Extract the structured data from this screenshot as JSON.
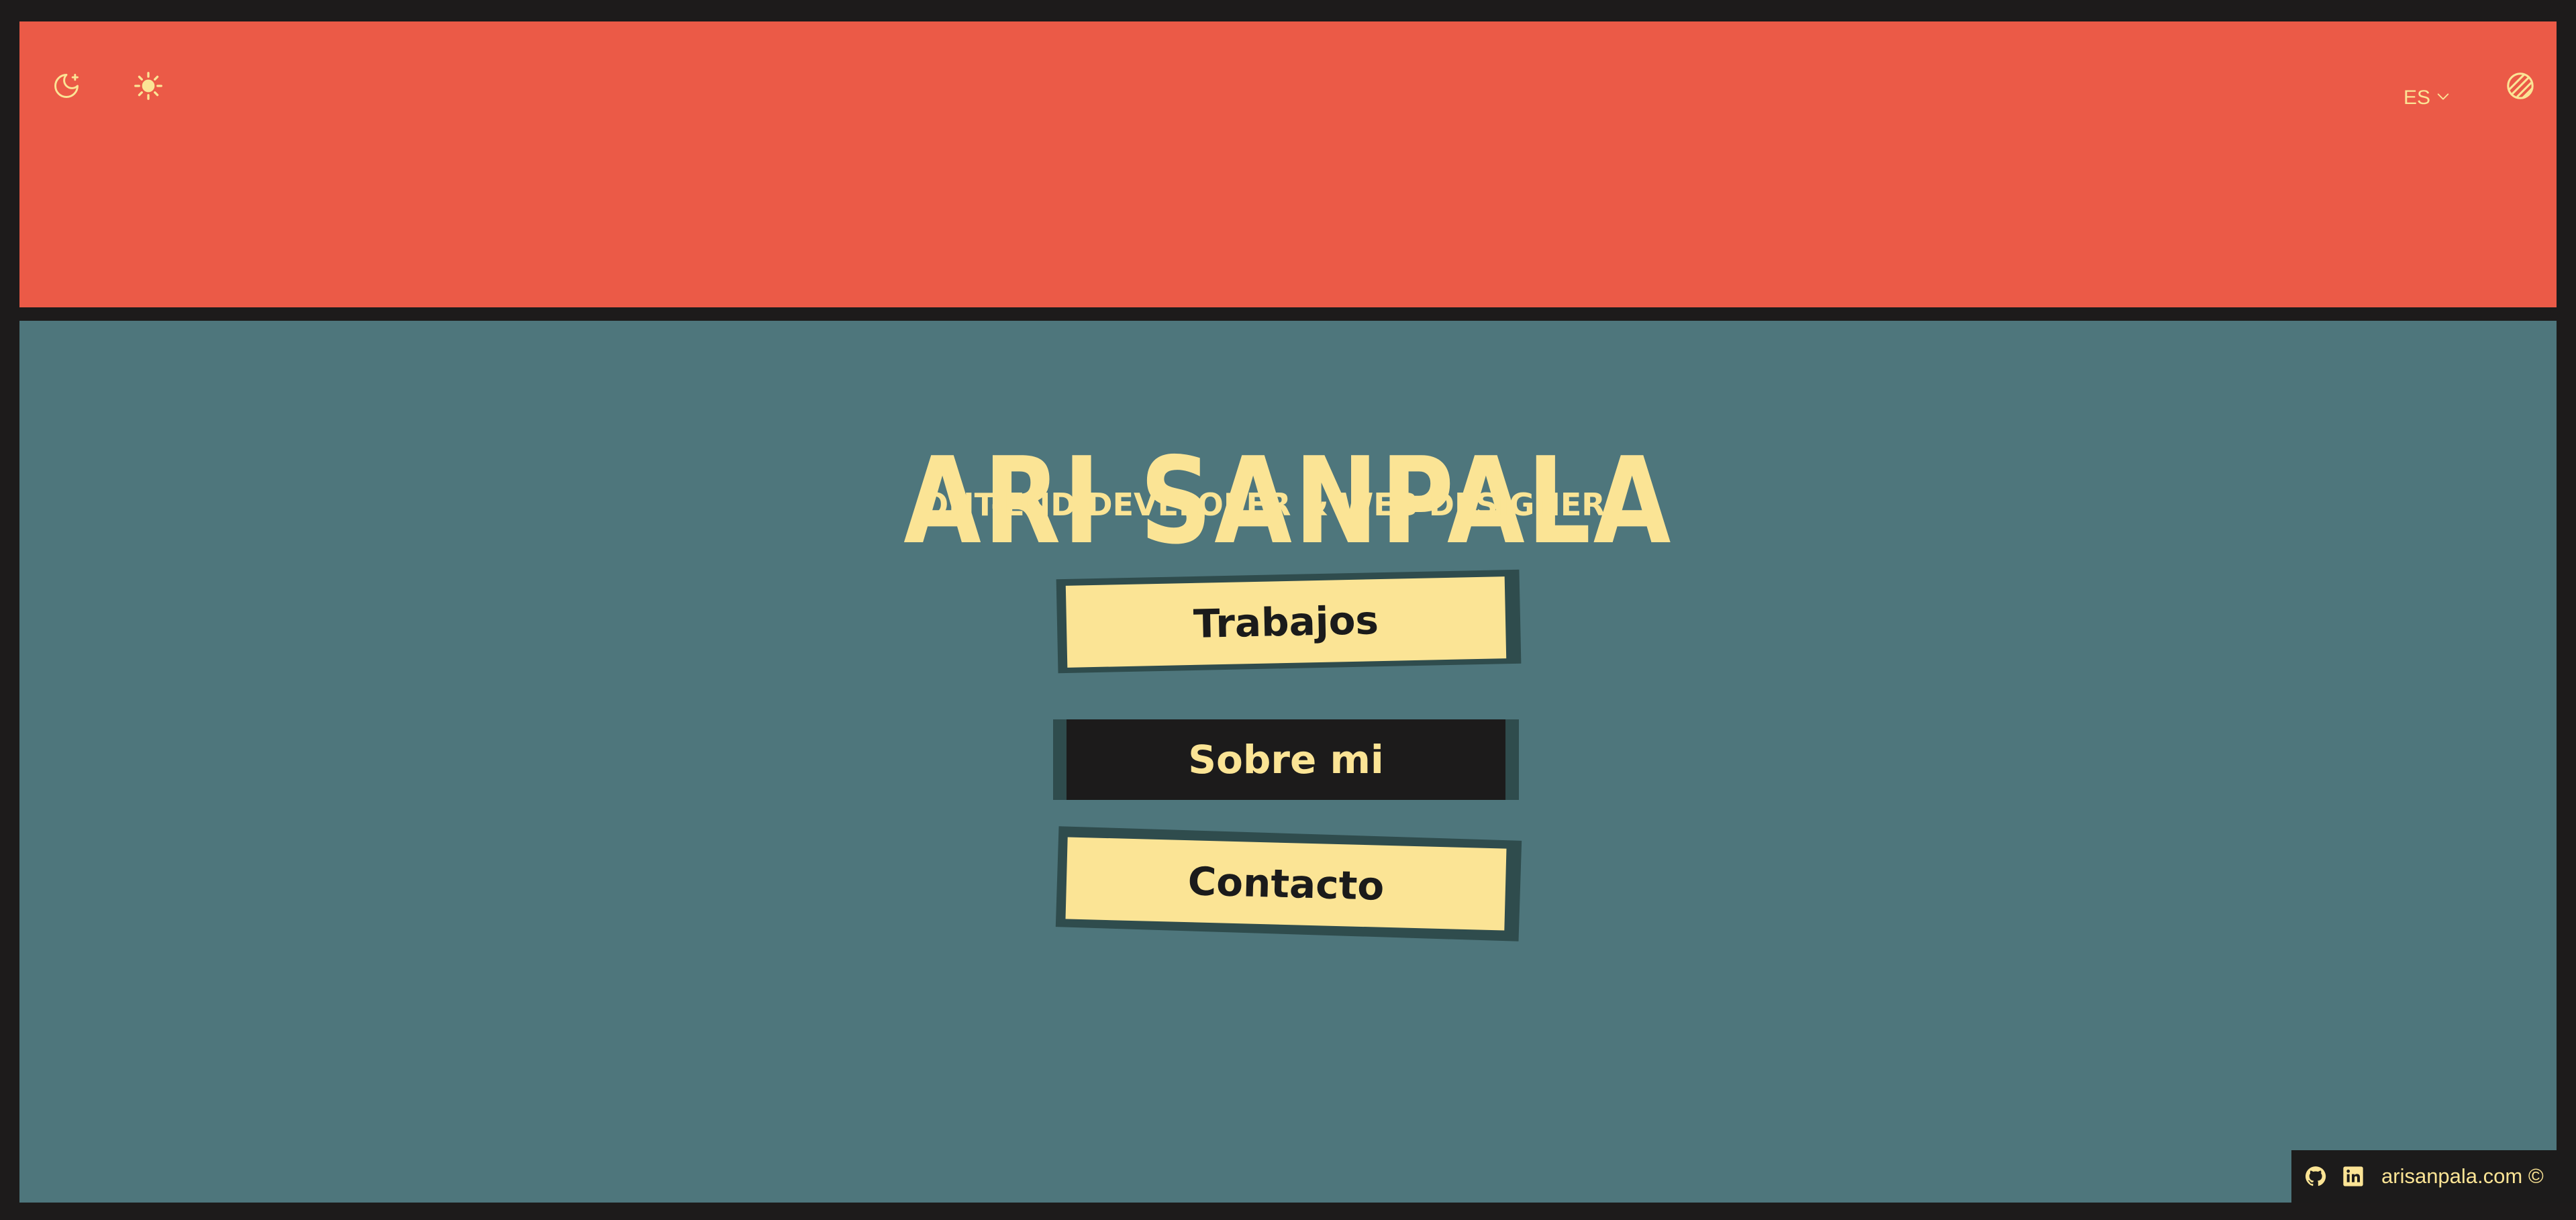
{
  "header": {
    "icons": [
      "moon-icon",
      "sun-icon",
      "contrast-icon"
    ],
    "lang_label": "ES",
    "lang_icon": "chevron-down-icon"
  },
  "main": {
    "title": "ARI SANPALA",
    "subtitle": "ONT-END DEVELOPER & WEB DESIGNER",
    "nav": [
      {
        "label": "Trabajos"
      },
      {
        "label": "Sobre mi"
      },
      {
        "label": "Contacto"
      }
    ]
  },
  "footer": {
    "icons": [
      "github-icon",
      "linkedin-icon"
    ],
    "copyright": "arisanpala.com ©"
  },
  "colors": {
    "header_bg": "#eb5a47",
    "main_bg": "#4e767c",
    "accent_yellow": "#fbe495",
    "dark": "#1c1b1b",
    "button_shadow": "#2f4c4d"
  }
}
